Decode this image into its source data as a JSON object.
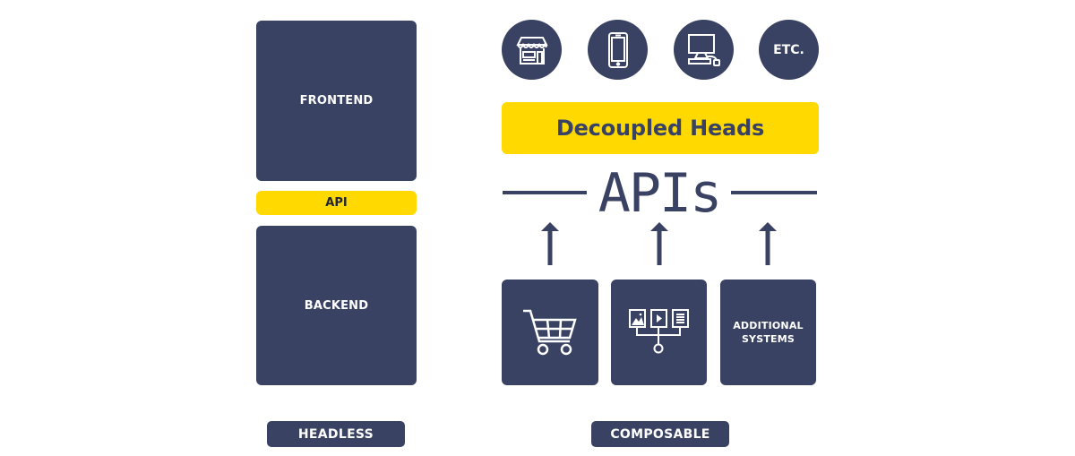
{
  "colors": {
    "navy": "#394263",
    "yellow": "#FFD900",
    "white": "#FFFFFF"
  },
  "headless": {
    "frontend_label": "FRONTEND",
    "api_label": "API",
    "backend_label": "BACKEND",
    "caption": "HEADLESS"
  },
  "composable": {
    "heads": [
      {
        "icon": "storefront-icon",
        "label": ""
      },
      {
        "icon": "smartphone-icon",
        "label": ""
      },
      {
        "icon": "desktop-computer-icon",
        "label": ""
      },
      {
        "icon": "",
        "label": "ETC."
      }
    ],
    "decoupled_heads_label": "Decoupled Heads",
    "apis_label": "APIs",
    "arrows": [
      "arrow-up-icon",
      "arrow-up-icon",
      "arrow-up-icon"
    ],
    "systems": [
      {
        "icon": "shopping-cart-icon",
        "label": ""
      },
      {
        "icon": "content-assets-icon",
        "label": ""
      },
      {
        "icon": "",
        "label_line1": "ADDITIONAL",
        "label_line2": "SYSTEMS"
      }
    ],
    "caption": "COMPOSABLE"
  }
}
